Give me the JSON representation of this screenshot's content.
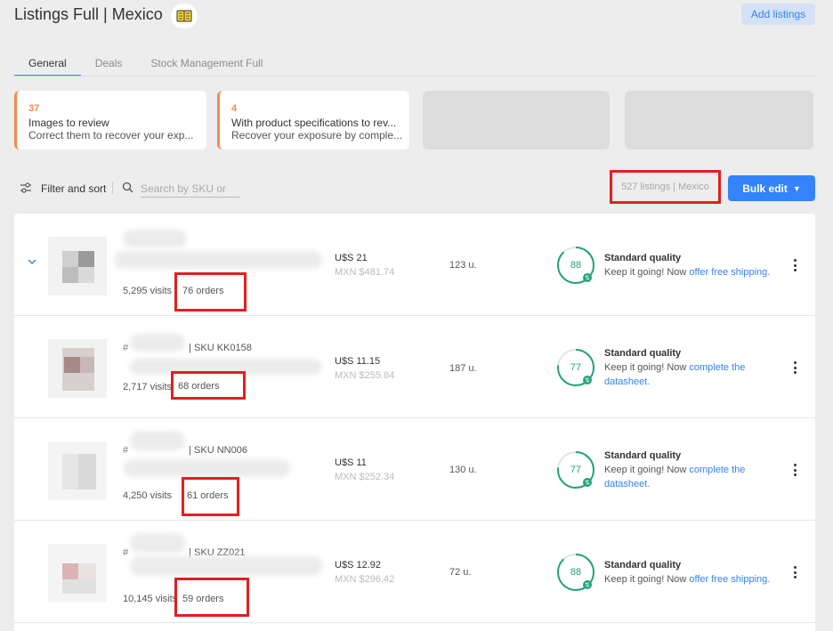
{
  "header": {
    "title": "Listings Full | Mexico",
    "add_listings_label": "Add listings"
  },
  "tabs": [
    {
      "label": "General",
      "active": true
    },
    {
      "label": "Deals",
      "active": false
    },
    {
      "label": "Stock Management Full",
      "active": false
    }
  ],
  "task_cards": [
    {
      "count": "37",
      "title": "Images to review",
      "subtitle": "Correct them to recover your exp..."
    },
    {
      "count": "4",
      "title": "With product specifications to rev...",
      "subtitle": "Recover your exposure by comple..."
    }
  ],
  "toolbar": {
    "filter_label": "Filter and sort",
    "search_placeholder": "Search by SKU or",
    "listings_count": "527 listings | Mexico",
    "bulk_edit_label": "Bulk edit"
  },
  "listings": [
    {
      "sku_prefix": "",
      "sku": "",
      "visits": "5,295 visits",
      "orders": "76 orders",
      "price_usd": "U$S 21",
      "price_mxn": "MXN $481.74",
      "stock": "123 u.",
      "score": "88",
      "score_fraction": 0.88,
      "quality_title": "Standard quality",
      "quality_text": "Keep it going! Now ",
      "quality_link": "offer free shipping."
    },
    {
      "sku_prefix": "#",
      "sku": "| SKU KK0158",
      "visits": "2,717 visits",
      "orders": "68 orders",
      "price_usd": "U$S 11.15",
      "price_mxn": "MXN $255.84",
      "stock": "187 u.",
      "score": "77",
      "score_fraction": 0.77,
      "quality_title": "Standard quality",
      "quality_text": "Keep it going! Now ",
      "quality_link": "complete the datasheet."
    },
    {
      "sku_prefix": "#",
      "sku": "| SKU NN006",
      "visits": "4,250 visits",
      "orders": "61 orders",
      "price_usd": "U$S 11",
      "price_mxn": "MXN $252.34",
      "stock": "130 u.",
      "score": "77",
      "score_fraction": 0.77,
      "quality_title": "Standard quality",
      "quality_text": "Keep it going! Now ",
      "quality_link": "complete the datasheet."
    },
    {
      "sku_prefix": "#",
      "sku": "| SKU ZZ021",
      "visits": "10,145 visits",
      "orders": "59 orders",
      "price_usd": "U$S 12.92",
      "price_mxn": "MXN $296.42",
      "stock": "72 u.",
      "score": "88",
      "score_fraction": 0.88,
      "quality_title": "Standard quality",
      "quality_text": "Keep it going! Now ",
      "quality_link": "offer free shipping."
    }
  ],
  "colors": {
    "accent": "#3483fa",
    "warning": "#f08a4b",
    "quality_green": "#23a27c",
    "highlight_red": "#e02020"
  },
  "icons": {
    "header": "book-icon",
    "filter": "sliders-icon",
    "search": "search-icon",
    "expand": "chevron-down-icon",
    "row_menu": "kebab-icon"
  }
}
